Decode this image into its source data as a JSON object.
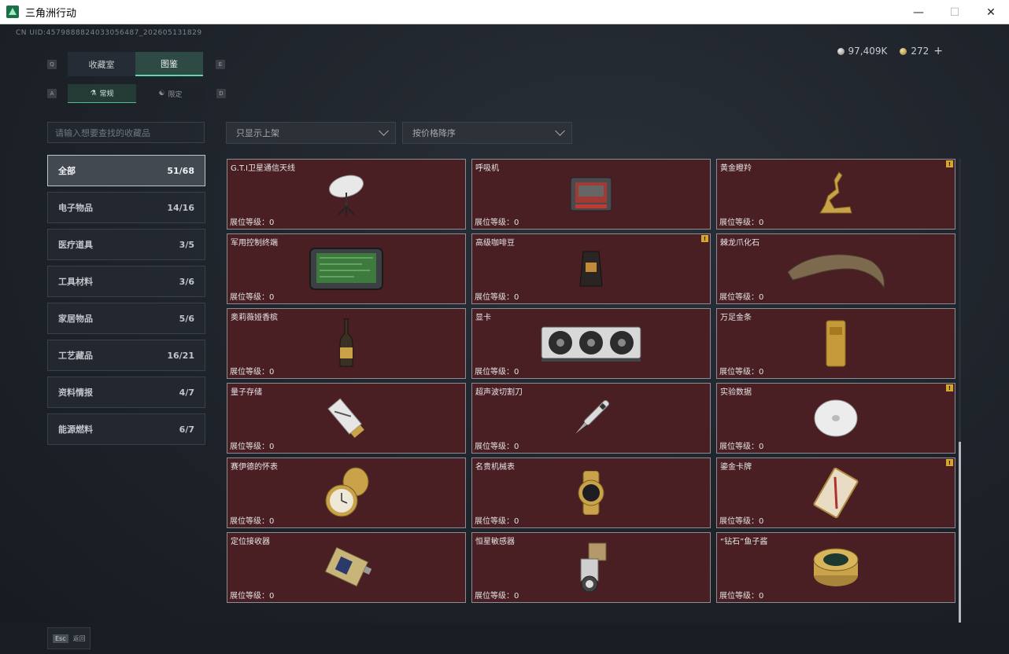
{
  "window": {
    "title": "三角洲行动"
  },
  "uid": "CN UID:4579888824033056487_202605131829",
  "currency": {
    "silver": "97,409K",
    "gold": "272",
    "plus": "+"
  },
  "hints": {
    "q": "Q",
    "e": "E",
    "a": "A",
    "d": "D"
  },
  "main_tabs": [
    {
      "label": "收藏室"
    },
    {
      "label": "图鉴"
    }
  ],
  "sub_tabs": [
    {
      "label": "常规"
    },
    {
      "label": "限定"
    }
  ],
  "search": {
    "placeholder": "请输入想要查找的收藏品"
  },
  "filters": {
    "shelf": "只显示上架",
    "sort": "按价格降序"
  },
  "categories": [
    {
      "label": "全部",
      "count": "51/68"
    },
    {
      "label": "电子物品",
      "count": "14/16"
    },
    {
      "label": "医疗道具",
      "count": "3/5"
    },
    {
      "label": "工具材料",
      "count": "3/6"
    },
    {
      "label": "家居物品",
      "count": "5/6"
    },
    {
      "label": "工艺藏品",
      "count": "16/21"
    },
    {
      "label": "资料情报",
      "count": "4/7"
    },
    {
      "label": "能源燃料",
      "count": "6/7"
    }
  ],
  "level_label": "展位等级：0",
  "items": [
    {
      "name": "G.T.I卫星通信天线",
      "icon": "satellite-dish-icon"
    },
    {
      "name": "呼吸机",
      "icon": "ventilator-icon"
    },
    {
      "name": "黄金瞪羚",
      "icon": "gold-gazelle-icon",
      "flag": "!"
    },
    {
      "name": "军用控制终端",
      "icon": "control-terminal-icon"
    },
    {
      "name": "高级咖啡豆",
      "icon": "coffee-bag-icon",
      "flag": "!"
    },
    {
      "name": "棘龙爪化石",
      "icon": "claw-fossil-icon"
    },
    {
      "name": "奥莉薇娅香槟",
      "icon": "champagne-icon"
    },
    {
      "name": "显卡",
      "icon": "graphics-card-icon"
    },
    {
      "name": "万足金条",
      "icon": "gold-bar-icon"
    },
    {
      "name": "量子存储",
      "icon": "quantum-storage-icon"
    },
    {
      "name": "超声波切割刀",
      "icon": "ultrasonic-knife-icon"
    },
    {
      "name": "实验数据",
      "icon": "data-disc-icon",
      "flag": "!"
    },
    {
      "name": "赛伊德的怀表",
      "icon": "pocket-watch-icon"
    },
    {
      "name": "名贵机械表",
      "icon": "wristwatch-icon"
    },
    {
      "name": "鎏金卡牌",
      "icon": "gilded-card-icon",
      "flag": "!"
    },
    {
      "name": "定位接收器",
      "icon": "gps-receiver-icon"
    },
    {
      "name": "恒星敏感器",
      "icon": "star-sensor-icon"
    },
    {
      "name": "“钻石”鱼子酱",
      "icon": "caviar-tin-icon"
    }
  ],
  "footer": {
    "esc_key": "Esc",
    "esc_label": "返回"
  }
}
